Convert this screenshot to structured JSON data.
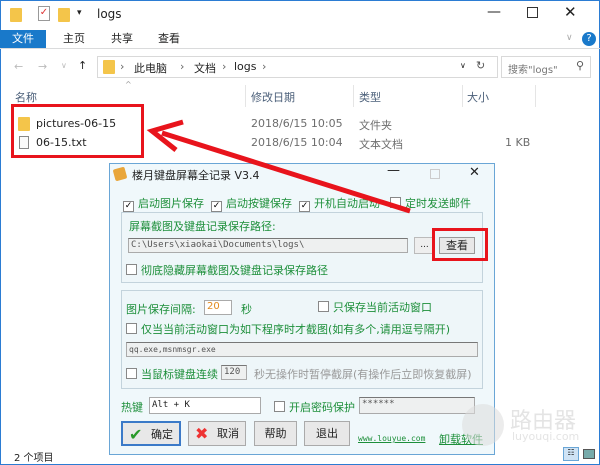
{
  "explorer": {
    "title": "logs",
    "ribbon_tabs": [
      "文件",
      "主页",
      "共享",
      "查看"
    ],
    "breadcrumb": [
      "此电脑",
      "文档",
      "logs"
    ],
    "search_placeholder": "搜索\"logs\"",
    "columns": [
      "名称",
      "修改日期",
      "类型",
      "大小"
    ],
    "files": [
      {
        "name": "pictures-06-15",
        "date": "2018/6/15 10:05",
        "type": "文件夹",
        "size": ""
      },
      {
        "name": "06-15.txt",
        "date": "2018/6/15 10:04",
        "type": "文本文档",
        "size": "1 KB"
      }
    ],
    "status": "2 个项目"
  },
  "dialog": {
    "title": "楼月键盘屏幕全记录 V3.4",
    "options": [
      {
        "label": "启动图片保存",
        "checked": true
      },
      {
        "label": "启动按键保存",
        "checked": true
      },
      {
        "label": "开机自动启动",
        "checked": true
      },
      {
        "label": "定时发送邮件",
        "checked": false
      }
    ],
    "path_label": "屏幕截图及键盘记录保存路径:",
    "path_value": "C:\\Users\\xiaokai\\Documents\\logs\\",
    "browse_label": "...",
    "view_label": "查看",
    "hide_path_label": "彻底隐藏屏幕截图及键盘记录保存路径",
    "interval_label": "图片保存间隔:",
    "interval_value": "20",
    "interval_unit": "秒",
    "active_only_label": "只保存当前活动窗口",
    "program_only_label": "仅当当前活动窗口为如下程序时才截图(如有多个,请用逗号隔开)",
    "programs_value": "qq.exe,msnmsgr.exe",
    "idle_label": "当鼠标键盘连续",
    "idle_value": "120",
    "idle_suffix": "秒无操作时暂停截屏(有操作后立即恢复截屏)",
    "hotkey_label": "热键",
    "hotkey_value": "Alt + K",
    "password_label": "开启密码保护",
    "password_value": "******",
    "buttons": [
      "确定",
      "取消",
      "帮助",
      "退出"
    ],
    "link": "www.louyue.com",
    "uninstall": "卸载软件"
  },
  "watermark": {
    "title": "路由器",
    "sub": "luyouqi.com"
  }
}
